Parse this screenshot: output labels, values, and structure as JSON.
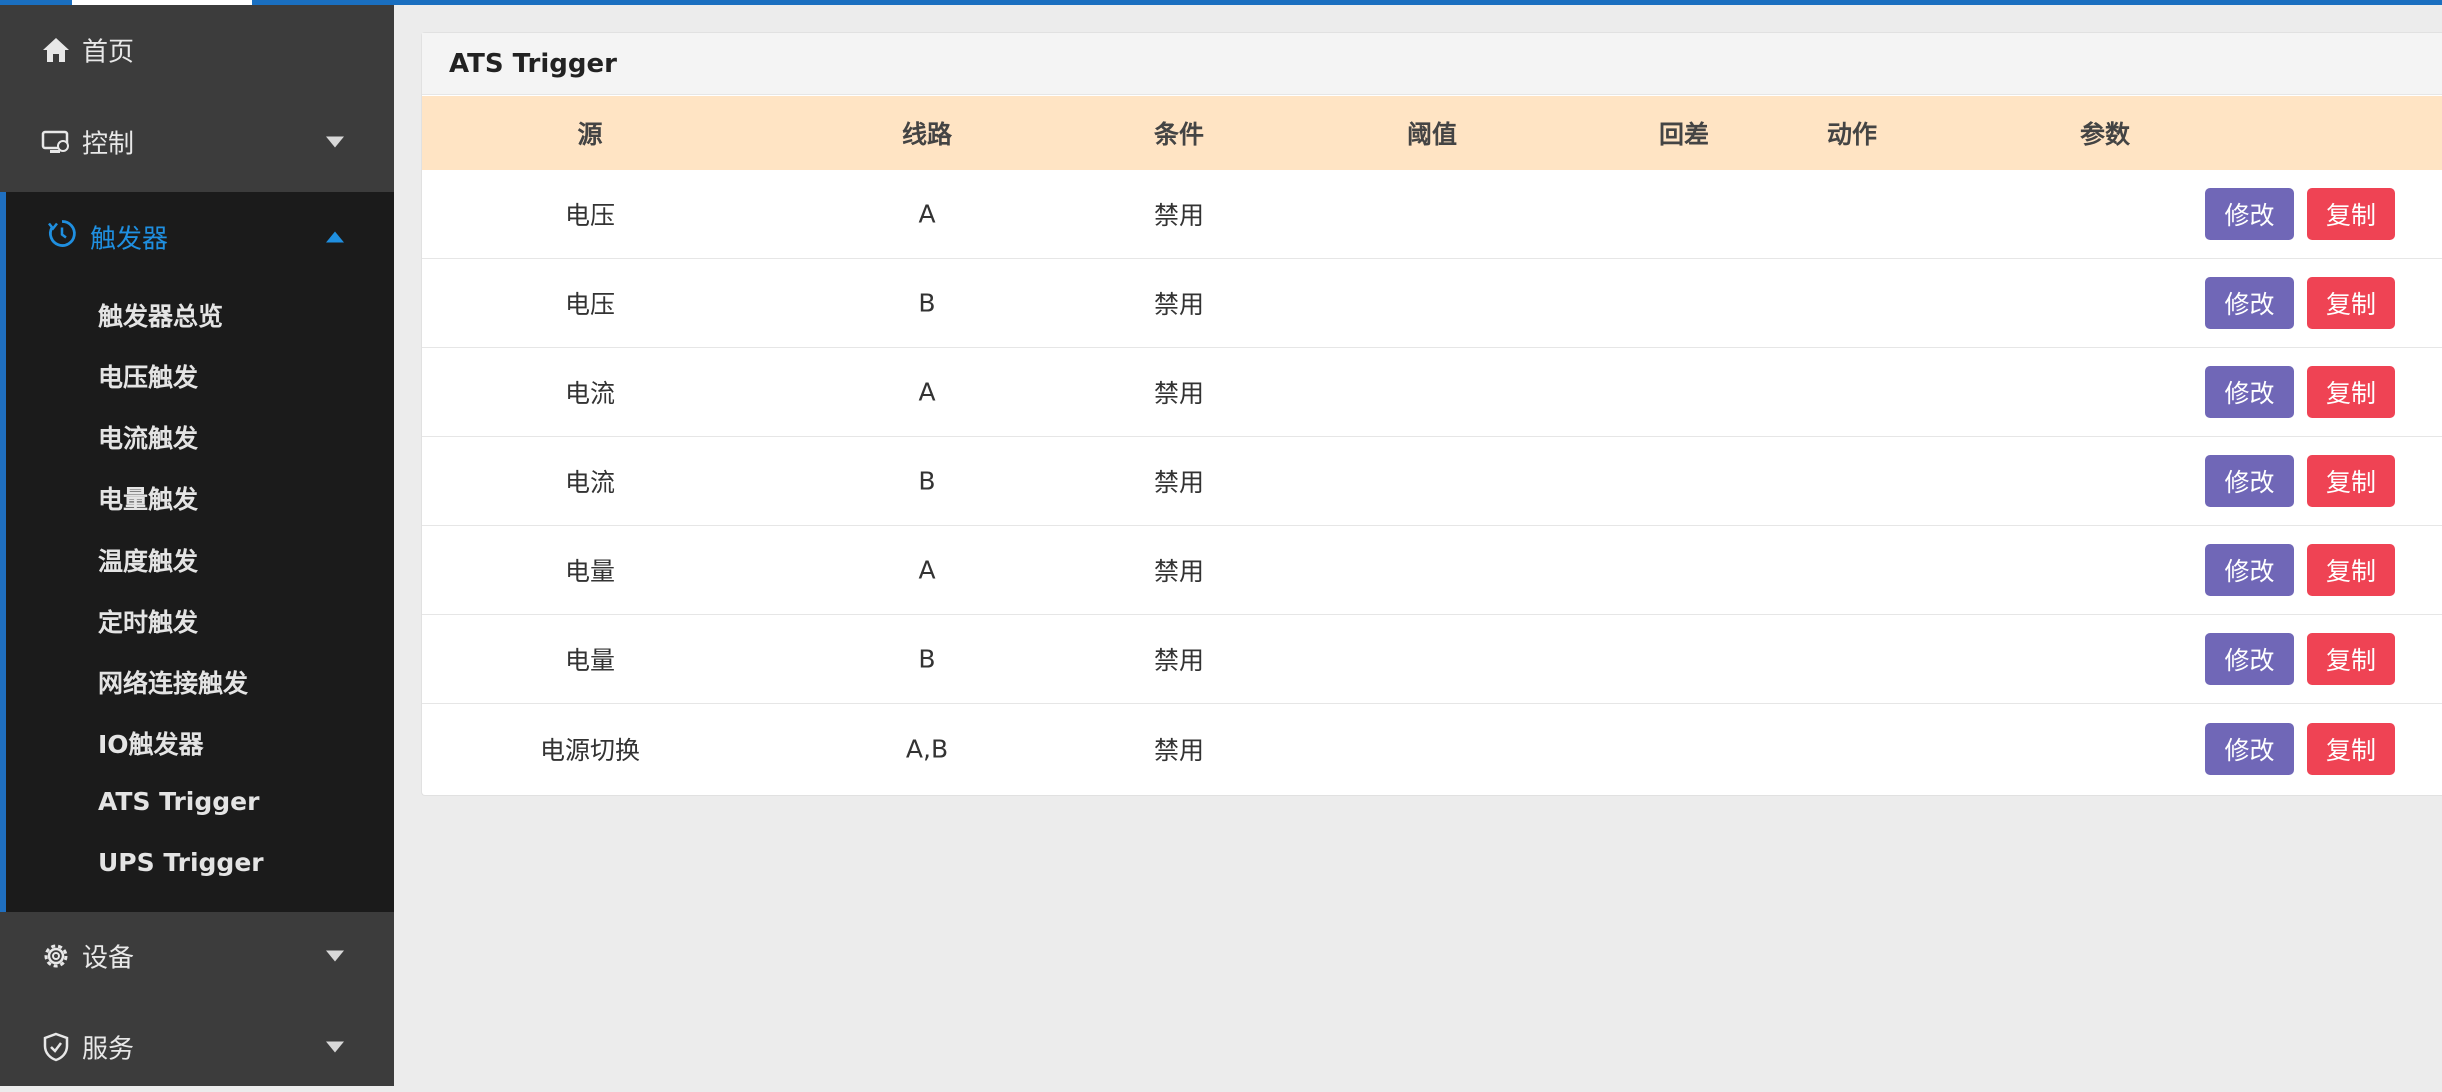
{
  "sidebar": {
    "home": {
      "label": "首页",
      "icon": "home-icon"
    },
    "control": {
      "label": "控制",
      "icon": "monitor-icon"
    },
    "trigger": {
      "label": "触发器",
      "icon": "trigger-icon",
      "items": [
        {
          "label": "触发器总览"
        },
        {
          "label": "电压触发"
        },
        {
          "label": "电流触发"
        },
        {
          "label": "电量触发"
        },
        {
          "label": "温度触发"
        },
        {
          "label": "定时触发"
        },
        {
          "label": "网络连接触发"
        },
        {
          "label": "IO触发器"
        },
        {
          "label": "ATS Trigger"
        },
        {
          "label": "UPS Trigger"
        }
      ]
    },
    "device": {
      "label": "设备",
      "icon": "gear-icon"
    },
    "service": {
      "label": "服务",
      "icon": "shield-check-icon"
    }
  },
  "panel": {
    "title": "ATS Trigger",
    "columns": [
      "源",
      "线路",
      "条件",
      "阈值",
      "回差",
      "动作",
      "参数"
    ],
    "rows": [
      {
        "source": "电压",
        "line": "A",
        "condition": "禁用",
        "threshold": "",
        "hysteresis": "",
        "action": "",
        "params": ""
      },
      {
        "source": "电压",
        "line": "B",
        "condition": "禁用",
        "threshold": "",
        "hysteresis": "",
        "action": "",
        "params": ""
      },
      {
        "source": "电流",
        "line": "A",
        "condition": "禁用",
        "threshold": "",
        "hysteresis": "",
        "action": "",
        "params": ""
      },
      {
        "source": "电流",
        "line": "B",
        "condition": "禁用",
        "threshold": "",
        "hysteresis": "",
        "action": "",
        "params": ""
      },
      {
        "source": "电量",
        "line": "A",
        "condition": "禁用",
        "threshold": "",
        "hysteresis": "",
        "action": "",
        "params": ""
      },
      {
        "source": "电量",
        "line": "B",
        "condition": "禁用",
        "threshold": "",
        "hysteresis": "",
        "action": "",
        "params": ""
      },
      {
        "source": "电源切换",
        "line": "A,B",
        "condition": "禁用",
        "threshold": "",
        "hysteresis": "",
        "action": "",
        "params": ""
      }
    ],
    "edit_label": "修改",
    "copy_label": "复制"
  },
  "colors": {
    "accent": "#1f8fe0",
    "edit_button": "#7067b7",
    "copy_button": "#ef4354",
    "table_header": "#ffe4c4",
    "sidebar": "#3c3c3c",
    "submenu": "#1b1b1b"
  }
}
